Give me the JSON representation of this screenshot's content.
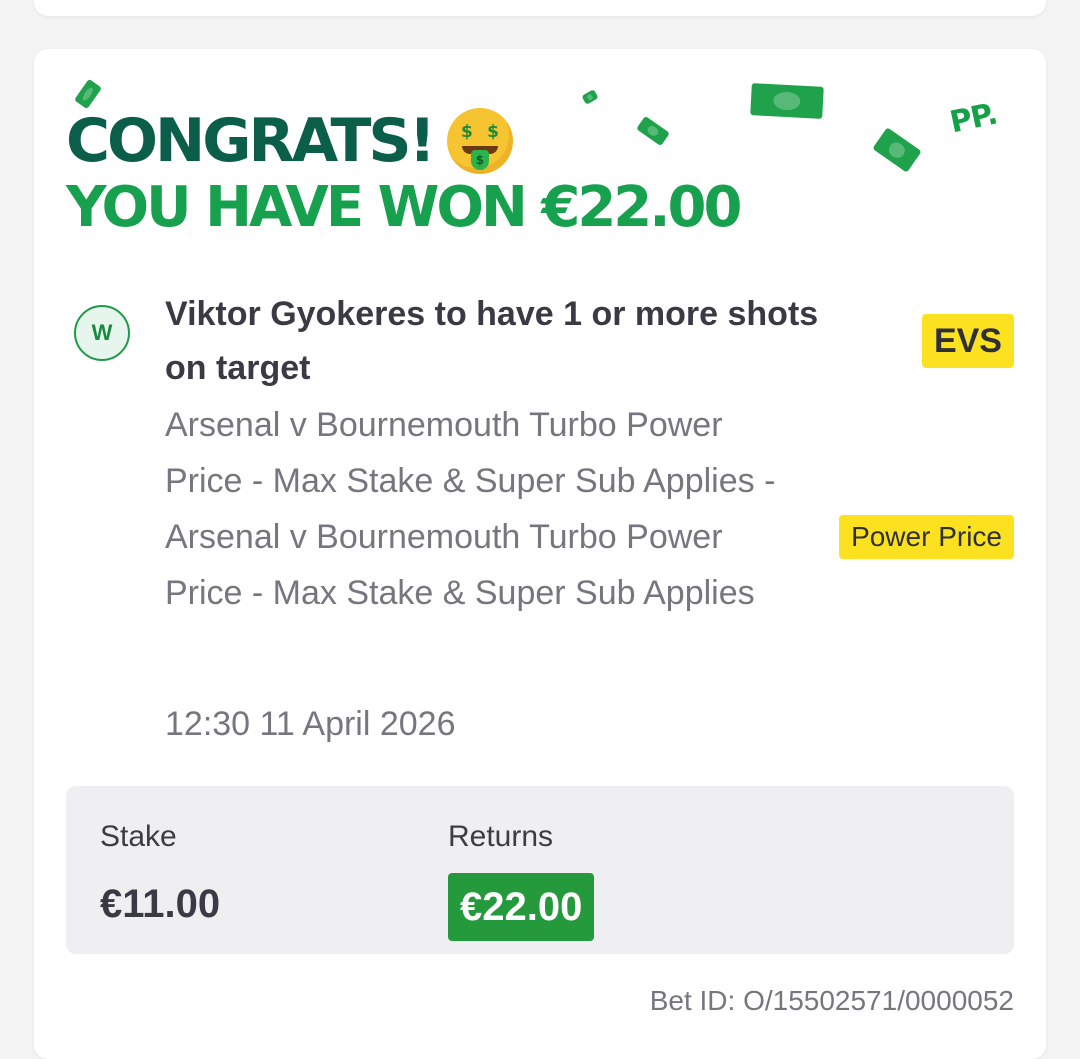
{
  "header": {
    "congrats": "CONGRATS!",
    "won_text": "YOU HAVE WON €22.00",
    "brand_mark": "PP.",
    "emoji_icon": "money-mouth-face-icon",
    "decor_icon": "banknote-icon"
  },
  "bet": {
    "status_badge": "W",
    "selection": "Viktor Gyokeres to have 1 or more shots on target",
    "odds": "EVS",
    "market": "Arsenal v Bournemouth Turbo Power Price - Max Stake & Super Sub Applies - Arsenal v Bournemouth Turbo Power Price - Max Stake & Super Sub Applies",
    "power_price_badge": "Power Price",
    "datetime": "12:30 11 April 2026"
  },
  "summary": {
    "stake_label": "Stake",
    "stake_value": "€11.00",
    "returns_label": "Returns",
    "returns_value": "€22.00"
  },
  "footer": {
    "bet_id": "Bet ID: O/15502571/0000052"
  },
  "colors": {
    "congrats_dark_green": "#0b5e4a",
    "won_green": "#17a04d",
    "badge_yellow": "#fbe11f",
    "returns_green": "#249a3c"
  }
}
